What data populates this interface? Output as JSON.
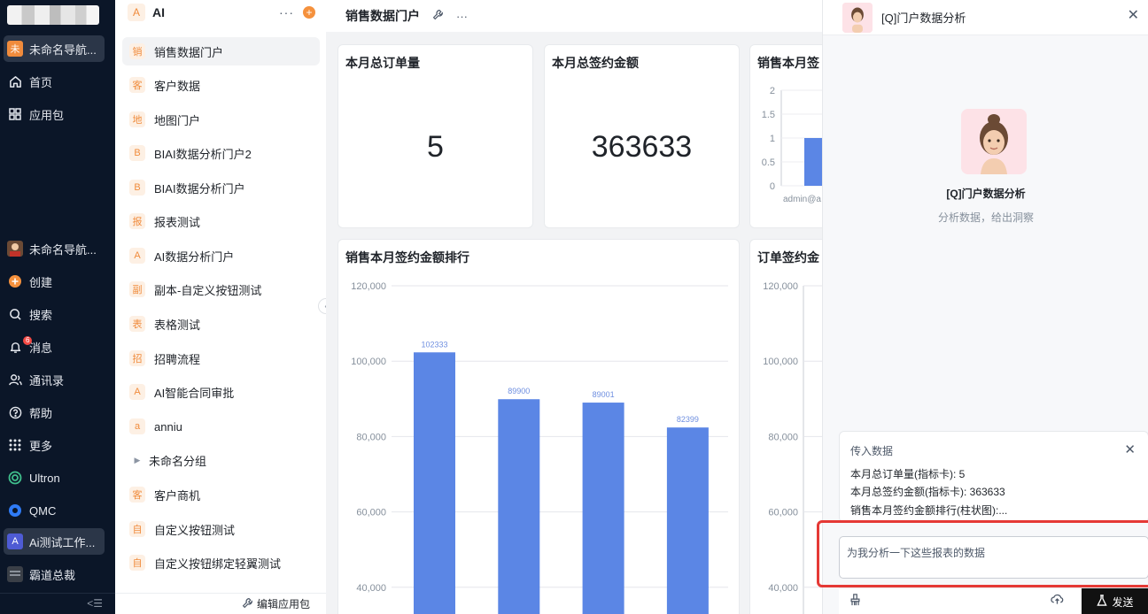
{
  "nav": {
    "items": [
      {
        "label": "未命名导航...",
        "badge": "未"
      },
      {
        "label": "首页"
      },
      {
        "label": "应用包"
      },
      {
        "label": "未命名导航..."
      },
      {
        "label": "创建"
      },
      {
        "label": "搜索"
      },
      {
        "label": "消息",
        "count": "6"
      },
      {
        "label": "通讯录"
      },
      {
        "label": "帮助"
      },
      {
        "label": "更多"
      },
      {
        "label": "Ultron"
      },
      {
        "label": "QMC"
      },
      {
        "label": "Ai测试工作...",
        "badge": "A"
      },
      {
        "label": "霸道总裁"
      }
    ],
    "collapse_glyph": "<☰"
  },
  "apps": {
    "title": "AI",
    "logo": "A",
    "more": "···",
    "add": "+",
    "items": [
      {
        "icon": "销",
        "label": "销售数据门户"
      },
      {
        "icon": "客",
        "label": "客户数据"
      },
      {
        "icon": "地",
        "label": "地图门户"
      },
      {
        "icon": "B",
        "label": "BIAI数据分析门户2"
      },
      {
        "icon": "B",
        "label": "BIAI数据分析门户"
      },
      {
        "icon": "报",
        "label": "报表测试"
      },
      {
        "icon": "A",
        "label": "AI数据分析门户"
      },
      {
        "icon": "副",
        "label": "副本-自定义按钮测试"
      },
      {
        "icon": "表",
        "label": "表格测试"
      },
      {
        "icon": "招",
        "label": "招聘流程"
      },
      {
        "icon": "A",
        "label": "AI智能合同审批"
      },
      {
        "icon": "a",
        "label": "anniu"
      },
      {
        "icon": "▶",
        "label": "未命名分组"
      },
      {
        "icon": "客",
        "label": "客户商机"
      },
      {
        "icon": "自",
        "label": "自定义按钮测试"
      },
      {
        "icon": "自",
        "label": "自定义按钮绑定轻翼测试"
      }
    ],
    "footer": "编辑应用包"
  },
  "main": {
    "title": "销售数据门户",
    "more": "···",
    "cards": {
      "orders": {
        "title": "本月总订单量",
        "value": "5"
      },
      "amount": {
        "title": "本月总签约金额",
        "value": "363633"
      },
      "sales_month": {
        "title": "销售本月签"
      },
      "ranking": {
        "title": "销售本月签约金额排行"
      },
      "order_amount": {
        "title": "订单签约金"
      }
    }
  },
  "chart_data": [
    {
      "type": "bar",
      "title": "销售本月签约金额排行",
      "values": [
        102333,
        89900,
        89001,
        82399
      ],
      "yticks": [
        "120,000",
        "100,000",
        "80,000",
        "60,000",
        "40,000"
      ],
      "ylim": [
        40000,
        120000
      ],
      "bar_color": "#5b86e5",
      "grid": true
    },
    {
      "type": "bar",
      "title": "销售本月签",
      "values": [
        1
      ],
      "yticks": [
        "2",
        "1.5",
        "1",
        "0.5",
        "0"
      ],
      "ylim": [
        0,
        2
      ],
      "xlabel_partial": "admin@a",
      "bar_color": "#5b86e5"
    },
    {
      "type": "bar",
      "title": "订单签约金",
      "yticks": [
        "120,000",
        "100,000",
        "80,000",
        "60,000",
        "40,000"
      ],
      "ylim": [
        40000,
        120000
      ]
    }
  ],
  "panel": {
    "title": "[Q]门户数据分析",
    "agent_name": "[Q]门户数据分析",
    "agent_desc": "分析数据，给出洞察",
    "data_title": "传入数据",
    "data_lines": [
      "本月总订单量(指标卡): 5",
      "本月总签约金额(指标卡): 363633",
      "销售本月签约金额排行(柱状图):..."
    ],
    "input_value": "为我分析一下这些报表的数据",
    "send_label": "发送",
    "accent": "#e53935"
  }
}
